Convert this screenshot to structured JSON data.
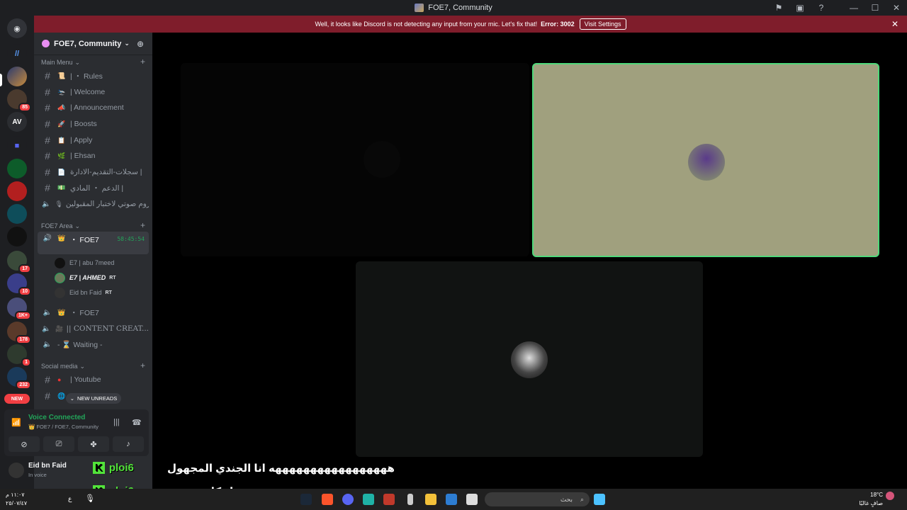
{
  "window": {
    "title": "FOE7, Community"
  },
  "banner": {
    "message": "Well, it looks like Discord is not detecting any input from your mic. Let's fix that!",
    "error": "Error: 3002",
    "button": "Visit Settings",
    "close": "✕"
  },
  "guilds": {
    "av_label": "AV",
    "badges": [
      "85",
      "17",
      "10",
      "1K+",
      "178",
      "1",
      "232"
    ],
    "new_label": "NEW"
  },
  "server": {
    "name": "FOE7, Community"
  },
  "categories": {
    "main_menu": "Main Menu",
    "area": "FOE7 Area",
    "social": "Social media"
  },
  "channels": {
    "rules": "| ・ Rules",
    "welcome": "| Welcome",
    "announcement": "| Announcement",
    "boosts": "| Boosts",
    "apply": "| Apply",
    "ehsan": "| Ehsan",
    "admin_logs": "سجلات-التقديم-الادارة |",
    "support": "الدعم ・ المادي |",
    "voice_test": "روم صوتي لاختبار المقبولين |",
    "foe7_voice": "・ FOE7",
    "timer": "58:45:54",
    "foe7_voice2": "・ FOE7",
    "content": "|| CONTENT CREAT...",
    "waiting": "- ⌛ Waiting -",
    "youtube": "| Youtube"
  },
  "members": [
    {
      "name": "E7 | abu 7meed",
      "tag": ""
    },
    {
      "name": "E7 | AHMED",
      "tag": "RT"
    },
    {
      "name": "Eid bn Faid",
      "tag": "RT"
    }
  ],
  "new_unreads": "NEW UNREADS",
  "voice": {
    "status": "Voice Connected",
    "location": "FOE7 / FOE7, Community"
  },
  "user": {
    "name": "Eid bn Faid",
    "status": "In voice"
  },
  "subtitles": {
    "line1": "هههههههههههههههههه انا الجندي المجهول",
    "line2": "ول كلهم متبندين",
    "watermark": "ploi6",
    "watermark_k": "K"
  },
  "taskbar": {
    "search_placeholder": "بحث",
    "time": "١١:٠٧ م",
    "date": "٢٥/٠٧/٤٧",
    "temp": "18°C",
    "weather": "صافٍ غالبًا",
    "lang": "ع"
  },
  "colors": {
    "accent_green": "#23a55a",
    "banner_red": "#7f1d2b",
    "speaking_border": "#4fd87a"
  }
}
